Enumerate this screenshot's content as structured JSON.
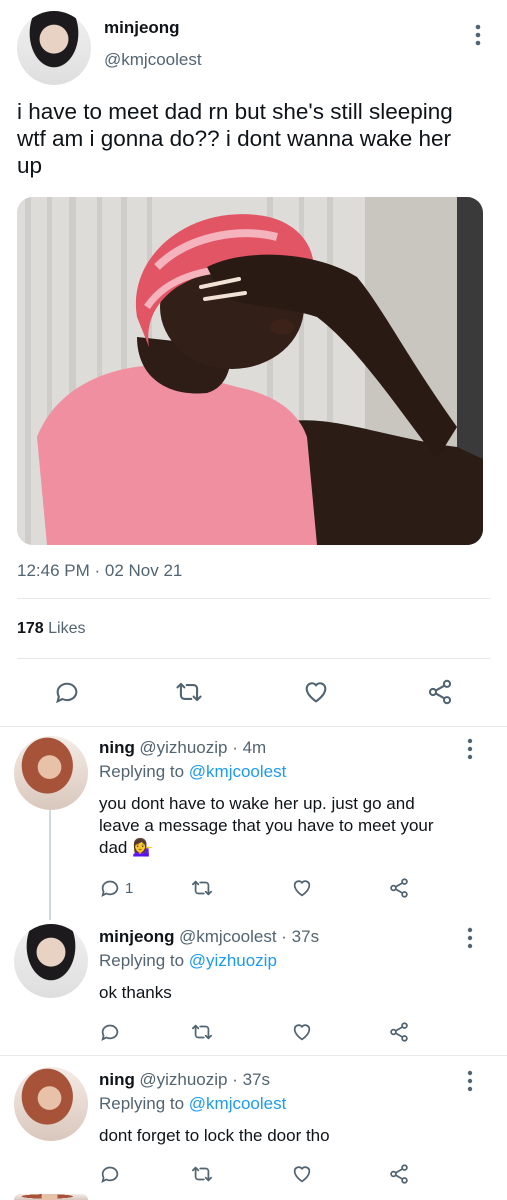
{
  "tweet": {
    "display_name": "minjeong",
    "handle": "@kmjcoolest",
    "text_line1": "i have to meet dad rn but she's still sleeping",
    "text_line2": "wtf am i gonna do?? i dont wanna wake her",
    "text_line3": "up",
    "timestamp": "12:46 PM · 02 Nov 21",
    "likes_count": "178",
    "likes_label": "Likes"
  },
  "replies": [
    {
      "name": "ning",
      "meta": "@yizhuozip · 4m",
      "replying_prefix": "Replying to ",
      "replying_to": "@kmjcoolest",
      "line1": "you dont have to wake her up. just go and",
      "line2": "leave a message that you have to meet your",
      "line3": "dad 💁‍♀️",
      "reply_count": "1"
    },
    {
      "name": "minjeong",
      "meta": "@kmjcoolest · 37s",
      "replying_prefix": "Replying to ",
      "replying_to": "@yizhuozip",
      "line1": "ok thanks"
    },
    {
      "name": "ning",
      "meta": "@yizhuozip · 37s",
      "replying_prefix": "Replying to ",
      "replying_to": "@kmjcoolest",
      "line1": "dont forget to lock the door tho"
    }
  ],
  "icons": {
    "reply": "reply-icon",
    "retweet": "retweet-icon",
    "like": "heart-icon",
    "share": "share-icon",
    "more": "more-options-icon"
  },
  "colors": {
    "link": "#1d9bf0",
    "muted": "#536471",
    "divider": "#e6e9eb"
  }
}
